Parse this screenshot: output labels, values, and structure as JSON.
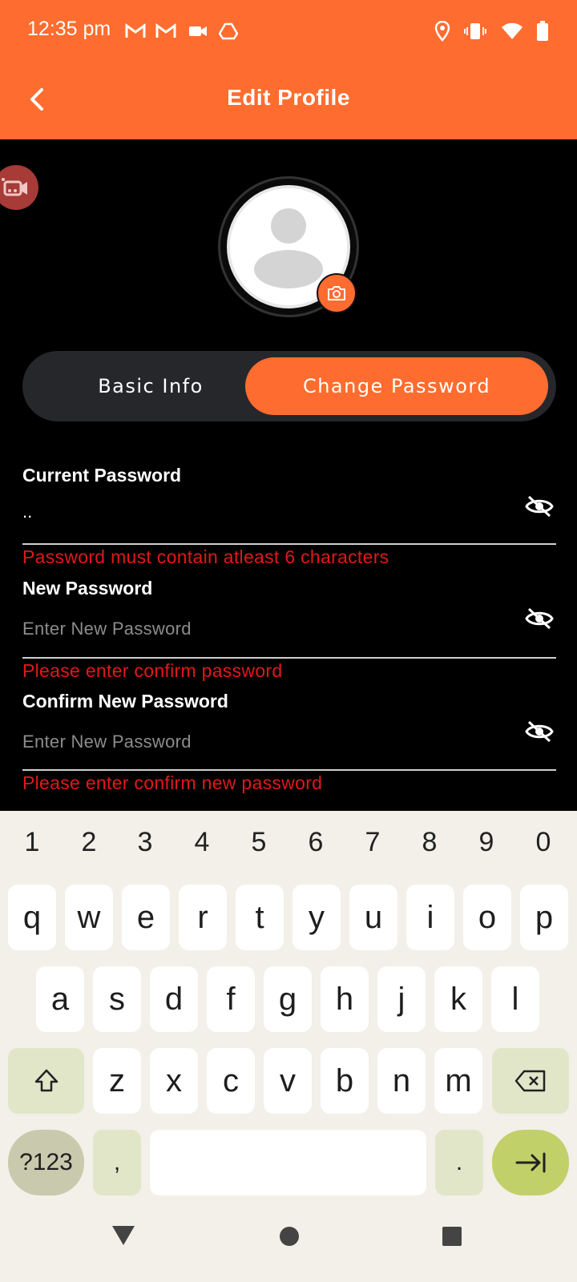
{
  "status_bar": {
    "time": "12:35 pm",
    "icons": [
      "gmail-icon",
      "gmail-icon",
      "video-icon",
      "drive-icon",
      "location-icon",
      "vibrate-icon",
      "wifi-icon",
      "battery-icon"
    ]
  },
  "app_bar": {
    "title": "Edit Profile",
    "back_icon": "chevron-left-icon"
  },
  "profile": {
    "avatar_icon": "default-user-icon",
    "camera_icon": "camera-icon"
  },
  "tabs": [
    {
      "label": "Basic Info",
      "selected": false
    },
    {
      "label": "Change Password",
      "selected": true
    }
  ],
  "form": {
    "current_password": {
      "label": "Current Password",
      "value": "..",
      "error": "Password must contain atleast 6 characters"
    },
    "new_password": {
      "label": "New Password",
      "placeholder": "Enter  New Password",
      "error": "Please enter confirm password"
    },
    "confirm_password": {
      "label": "Confirm New Password",
      "placeholder": "Enter   New Password",
      "error": "Please enter confirm new password"
    }
  },
  "keyboard": {
    "numbers": [
      "1",
      "2",
      "3",
      "4",
      "5",
      "6",
      "7",
      "8",
      "9",
      "0"
    ],
    "row1": [
      "q",
      "w",
      "e",
      "r",
      "t",
      "y",
      "u",
      "i",
      "o",
      "p"
    ],
    "row2": [
      "a",
      "s",
      "d",
      "f",
      "g",
      "h",
      "j",
      "k",
      "l"
    ],
    "row3": [
      "z",
      "x",
      "c",
      "v",
      "b",
      "n",
      "m"
    ],
    "symbols_label": "?123",
    "comma": ",",
    "period": "."
  },
  "colors": {
    "accent": "#ff6c2f",
    "error": "#e11919",
    "background": "#000000"
  }
}
